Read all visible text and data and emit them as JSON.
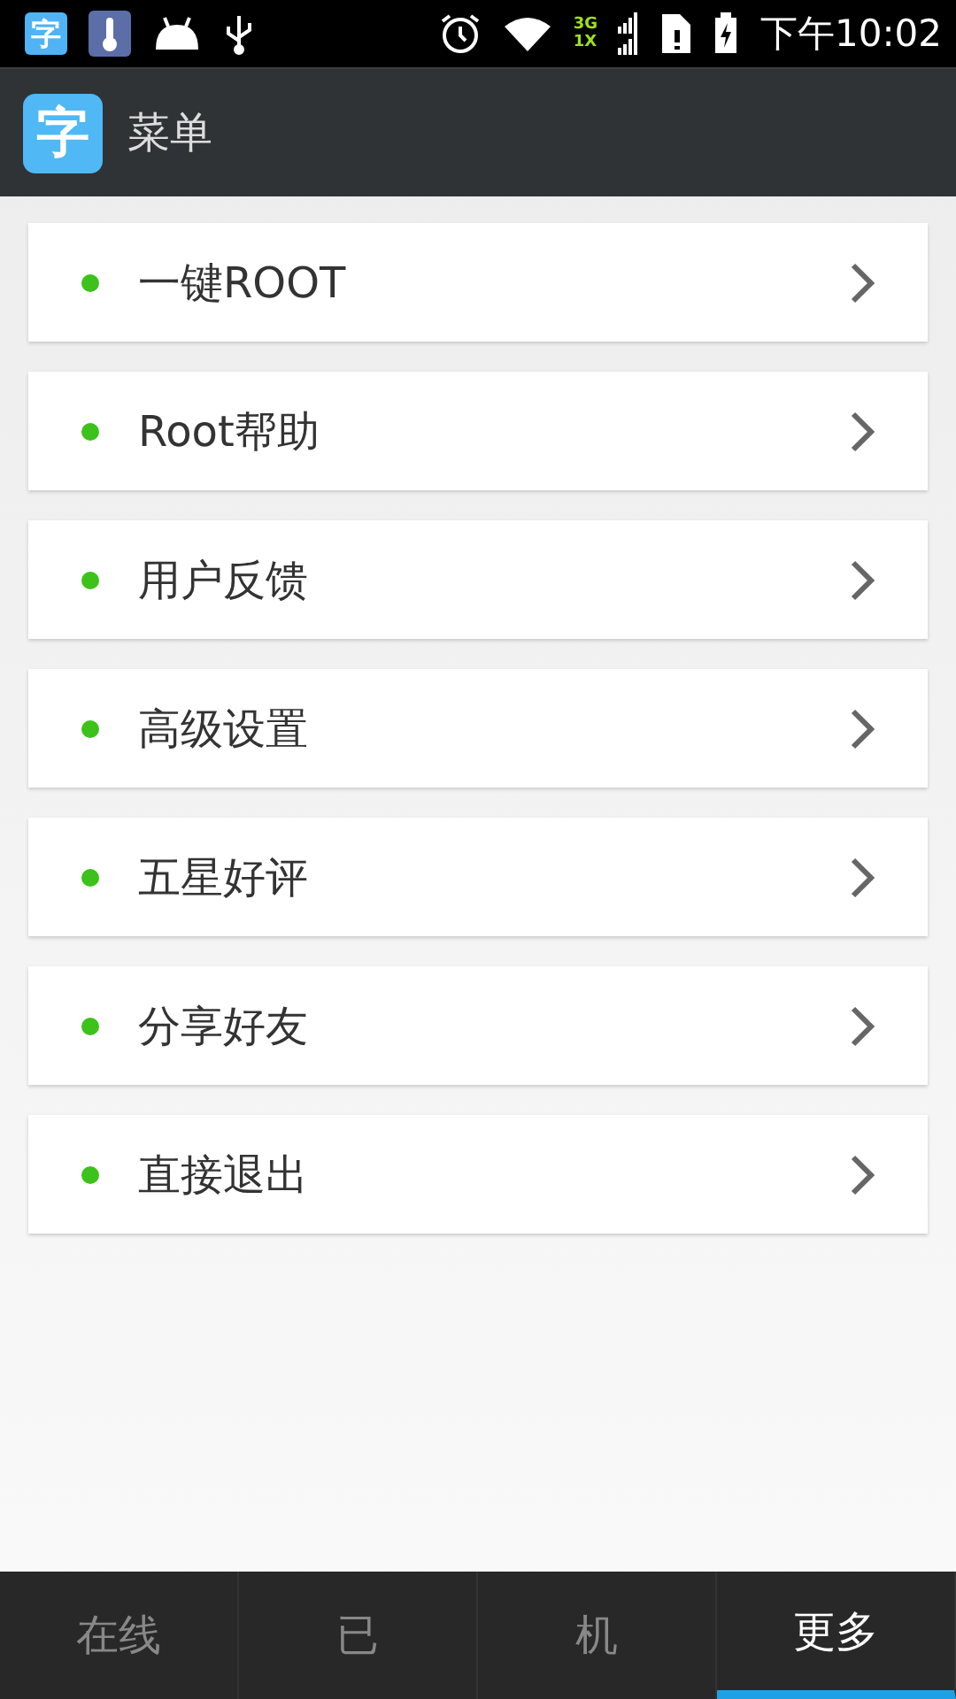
{
  "status_bar": {
    "app_glyph": "字",
    "network_top": "3G",
    "network_bottom": "1X",
    "time": "下午10:02"
  },
  "app_bar": {
    "icon_glyph": "字",
    "title": "菜单"
  },
  "menu_items": [
    {
      "label": "一键ROOT",
      "color": "#3cc21a"
    },
    {
      "label": "Root帮助",
      "color": "#3cc21a"
    },
    {
      "label": "用户反馈",
      "color": "#3cc21a"
    },
    {
      "label": "高级设置",
      "color": "#3cc21a"
    },
    {
      "label": "五星好评",
      "color": "#3cc21a"
    },
    {
      "label": "分享好友",
      "color": "#3cc21a"
    },
    {
      "label": "直接退出",
      "color": "#3cc21a"
    }
  ],
  "tabs": [
    {
      "label": "在线",
      "selected": false
    },
    {
      "label": "已",
      "selected": false
    },
    {
      "label": "机",
      "selected": false
    },
    {
      "label": "更多",
      "selected": true
    }
  ]
}
